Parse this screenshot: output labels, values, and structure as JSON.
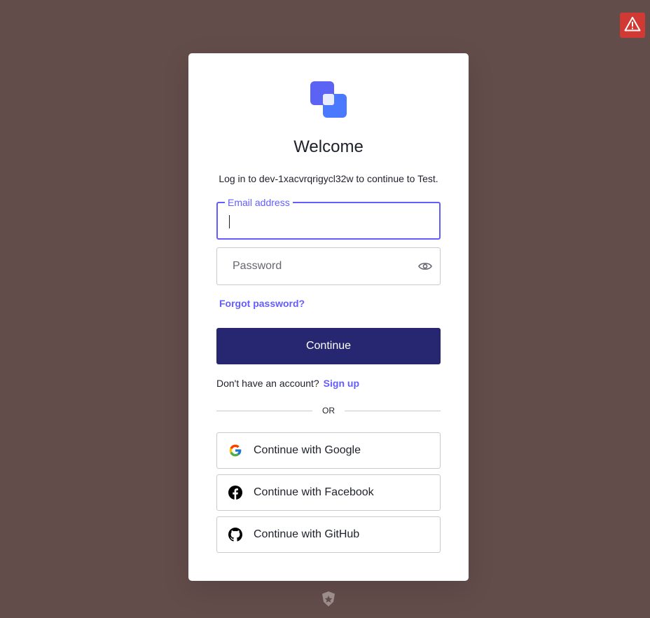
{
  "alert": {
    "icon": "warning-icon",
    "color": "#d13a34"
  },
  "brand": {
    "logo_icon": "app-logo-icon",
    "accent": "#635dff",
    "primary": "#272671"
  },
  "login": {
    "title": "Welcome",
    "subtitle": "Log in to dev-1xacvrqrigycl32w to continue to Test.",
    "email": {
      "label": "Email address",
      "value": ""
    },
    "password": {
      "placeholder": "Password",
      "toggle_icon": "eye-icon"
    },
    "forgot_label": "Forgot password?",
    "continue_label": "Continue",
    "signup_prompt": "Don't have an account?",
    "signup_label": "Sign up",
    "divider_label": "OR",
    "social": [
      {
        "label": "Continue with Google",
        "icon": "google-icon"
      },
      {
        "label": "Continue with Facebook",
        "icon": "facebook-icon"
      },
      {
        "label": "Continue with GitHub",
        "icon": "github-icon"
      }
    ]
  },
  "footer": {
    "icon": "auth0-badge-icon"
  }
}
